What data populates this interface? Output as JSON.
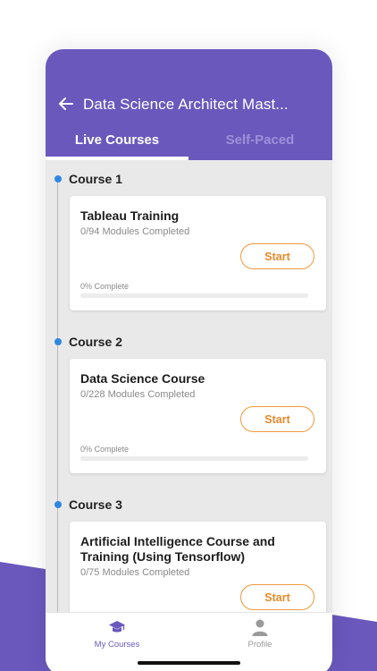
{
  "header": {
    "title": "Data Science Architect Mast...",
    "back_icon": "arrow-left-icon",
    "color": "#6a58bd"
  },
  "tabs": [
    {
      "label": "Live Courses",
      "active": true
    },
    {
      "label": "Self-Paced",
      "active": false
    }
  ],
  "courses": [
    {
      "label": "Course 1",
      "title": "Tableau Training",
      "modules": "0/94 Modules Completed",
      "button": "Start",
      "progress_text": "0% Complete",
      "progress": 0
    },
    {
      "label": "Course 2",
      "title": "Data Science Course",
      "modules": "0/228 Modules Completed",
      "button": "Start",
      "progress_text": "0% Complete",
      "progress": 0
    },
    {
      "label": "Course 3",
      "title": "Artificial Intelligence Course and Training (Using Tensorflow)",
      "modules": "0/75 Modules Completed",
      "button": "Start"
    }
  ],
  "bottom_nav": [
    {
      "label": "My Courses",
      "icon": "graduation-cap-icon",
      "active": true
    },
    {
      "label": "Profile",
      "icon": "user-icon",
      "active": false
    }
  ],
  "colors": {
    "accent": "#6a58bd",
    "button": "#ef9a3c",
    "timeline_dot": "#2f87e0"
  }
}
